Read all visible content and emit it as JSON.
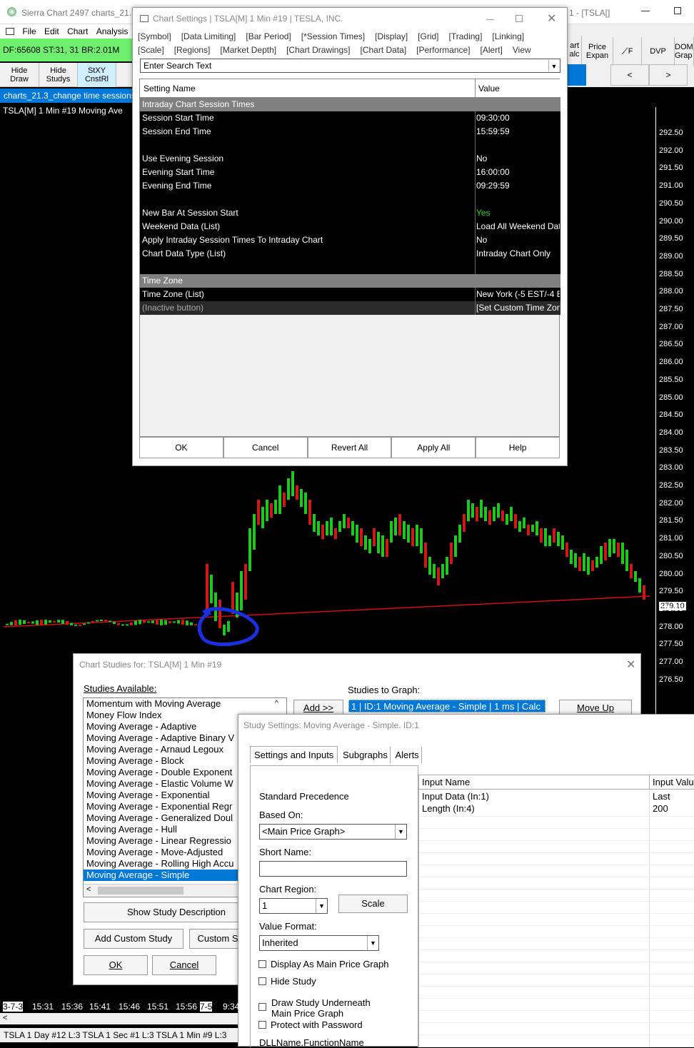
{
  "app": {
    "title": "Sierra Chart 2497 charts_21.3_",
    "title_right": "1 - [TSLA[]",
    "menu": [
      "File",
      "Edit",
      "Chart",
      "Analysis"
    ],
    "status": "DF:65608  ST:31, 31  BR:2.01M",
    "tab": "charts_21.3_change time sessions",
    "chart_label": "TSLA[M]  1 Min  #19 Moving Ave"
  },
  "toolbar": {
    "hide_draw": "Hide Draw",
    "hide_studys": "Hide Studys",
    "stxy": "StXY CnstRl"
  },
  "right_toolbar": {
    "chart_calc": "art alc",
    "price_expan": "Price Expan",
    "f": "F",
    "dvp": "DVP",
    "dom": "DOM Grap",
    "prev": "<",
    "next": ">"
  },
  "axis": {
    "labels": [
      "292.50",
      "292.00",
      "291.50",
      "291.00",
      "290.50",
      "290.00",
      "289.50",
      "289.00",
      "288.50",
      "288.00",
      "287.50",
      "287.00",
      "286.50",
      "286.00",
      "285.50",
      "285.00",
      "284.50",
      "284.00",
      "283.50",
      "283.00",
      "282.50",
      "282.00",
      "281.50",
      "281.00",
      "280.50",
      "280.00",
      "279.50",
      "279.10",
      "278.50",
      "278.00",
      "277.50",
      "277.00",
      "276.50"
    ]
  },
  "chart_settings": {
    "title": "Chart Settings | TSLA[M]  1 Min  #19 | TESLA, INC.",
    "tabs_row1": [
      "[Symbol]",
      "[Data Limiting]",
      "[Bar Period]",
      "[*Session Times]",
      "[Display]",
      "[Grid]",
      "[Trading]",
      "[Linking]"
    ],
    "tabs_row2": [
      "[Scale]",
      "[Regions]",
      "[Market Depth]",
      "[Chart Drawings]",
      "[Chart Data]",
      "[Performance]",
      "[Alert]",
      "View"
    ],
    "search_placeholder": "Enter Search Text",
    "col_name": "Setting Name",
    "col_value": "Value",
    "section1": "Intraday Chart Session Times",
    "rows": [
      {
        "name": "Session Start Time",
        "value": "09:30:00"
      },
      {
        "name": "Session End Time",
        "value": "15:59:59"
      },
      {
        "name": "Use Evening Session",
        "value": "No"
      },
      {
        "name": "Evening Start Time",
        "value": "16:00:00"
      },
      {
        "name": "Evening End Time",
        "value": "09:29:59"
      },
      {
        "name": "New Bar At Session Start",
        "value": "Yes"
      },
      {
        "name": "Weekend Data (List)",
        "value": "Load All Weekend Dat"
      },
      {
        "name": "Apply Intraday Session Times To Intraday Chart",
        "value": "No"
      },
      {
        "name": "Chart Data Type (List)",
        "value": "Intraday Chart Only"
      },
      {
        "name": "Time Zone (List)",
        "value": "New York (-5 EST/-4 ED"
      },
      {
        "name": "(Inactive button)",
        "value": "[Set Custom Time Zon"
      }
    ],
    "section2": "Time Zone",
    "buttons": [
      "OK",
      "Cancel",
      "Revert All",
      "Apply All",
      "Help"
    ]
  },
  "studies": {
    "title": "Chart Studies for: TSLA[M]  1 Min  #19",
    "available_label": "Studies Available:",
    "to_graph_label": "Studies to Graph:",
    "add_btn": "Add >>",
    "move_up": "Move Up",
    "graph_item": "1 | ID:1  Moving Average - Simple | 1 ms | Calc",
    "list": [
      "Momentum with Moving Average",
      "Money Flow Index",
      "Moving Average - Adaptive",
      "Moving Average - Adaptive Binary V",
      "Moving Average - Arnaud Legoux",
      "Moving Average - Block",
      "Moving Average - Double Exponent",
      "Moving Average - Elastic Volume W",
      "Moving Average - Exponential",
      "Moving Average - Exponential Regr",
      "Moving Average - Generalized Doul",
      "Moving Average - Hull",
      "Moving Average - Linear Regressio",
      "Moving Average - Move-Adjusted",
      "Moving Average - Rolling High Accu",
      "Moving Average - Simple"
    ],
    "show_desc": "Show Study Description",
    "add_custom": "Add Custom Study",
    "custom": "Custom S",
    "ok": "OK",
    "cancel": "Cancel"
  },
  "study_settings": {
    "title": "Study Settings: Moving Average - Simple. ID:1",
    "tabs": [
      "Settings and Inputs",
      "Subgraphs",
      "Alerts"
    ],
    "standard_precedence": "Standard Precedence",
    "based_on_label": "Based On:",
    "based_on": "<Main Price Graph>",
    "short_name_label": "Short Name:",
    "chart_region_label": "Chart Region:",
    "chart_region": "1",
    "scale_btn": "Scale",
    "value_format_label": "Value Format:",
    "value_format": "Inherited",
    "checks": [
      "Display As Main Price Graph",
      "Hide Study",
      "Draw Study Underneath Main Price Graph",
      "Protect with Password"
    ],
    "dll": "DLLName.FunctionName",
    "input_name": "Input Name",
    "input_value": "Input Valu",
    "inputs": [
      {
        "name": "Input Data  (In:1)",
        "value": "Last"
      },
      {
        "name": "Length  (In:4)",
        "value": "200"
      }
    ]
  },
  "bottom": {
    "times": [
      "3-7-3",
      "15:31",
      "15:36",
      "15:41",
      "15:46",
      "15:51",
      "15:56",
      "7-5",
      "9:34"
    ],
    "tabs": "TSLA  1 Day  #12 L:3   TSLA  1 Sec  #1 L:3   TSLA  1 Min  #9 L:3"
  }
}
